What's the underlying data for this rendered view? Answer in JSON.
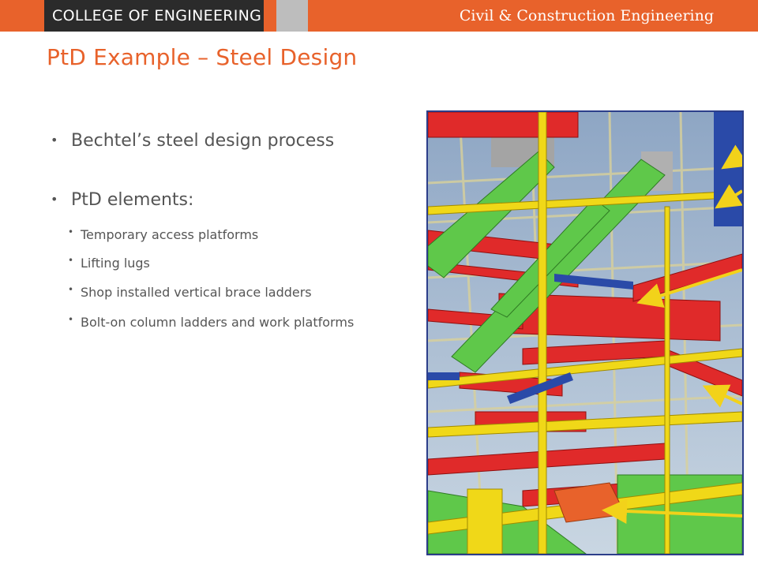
{
  "header": {
    "college": "COLLEGE OF ENGINEERING",
    "department": "Civil & Construction Engineering"
  },
  "slide": {
    "title": "PtD Example – Steel Design",
    "bullets": [
      {
        "text": "Bechtel’s steel design process"
      },
      {
        "text": "PtD elements:"
      }
    ],
    "sub_bullets": [
      {
        "text": "Temporary access platforms"
      },
      {
        "text": "Lifting lugs"
      },
      {
        "text": "Shop installed vertical brace ladders"
      },
      {
        "text": "Bolt-on column ladders and work platforms"
      }
    ]
  },
  "colors": {
    "accent_orange": "#e8622b",
    "header_dark": "#2b2b2b",
    "steel_red": "#e02a2a",
    "steel_green": "#5fc84a",
    "steel_yellow": "#f0d818",
    "steel_blue": "#2a4aa8"
  }
}
